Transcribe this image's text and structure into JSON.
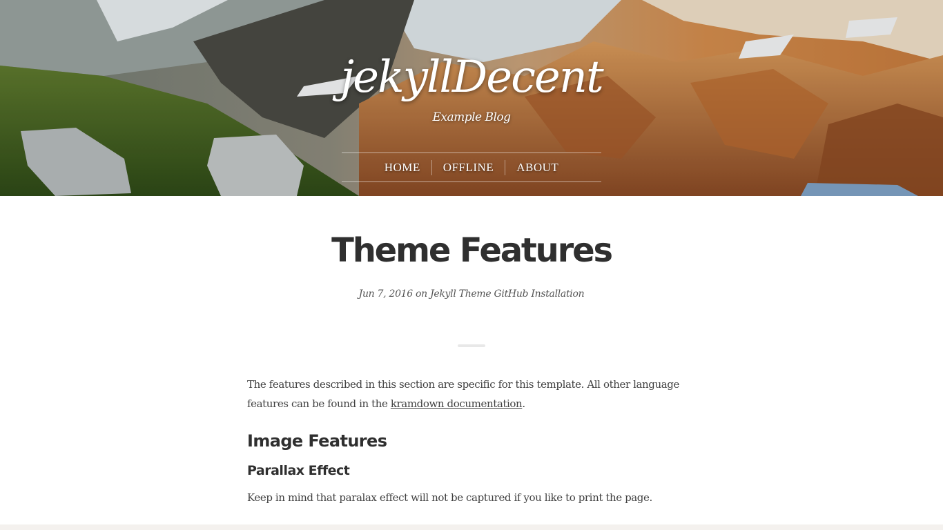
{
  "site": {
    "title": "jekyllDecent",
    "tagline": "Example Blog"
  },
  "nav": {
    "items": [
      {
        "label": "HOME"
      },
      {
        "label": "OFFLINE"
      },
      {
        "label": "ABOUT"
      }
    ]
  },
  "post": {
    "title": "Theme Features",
    "meta": {
      "date": "Jun 7, 2016",
      "on": "on",
      "tags": [
        "Jekyll",
        "Theme",
        "GitHub",
        "Installation"
      ]
    },
    "intro": {
      "text_before": "The features described in this section are specific for this template. All other language features can be found in the ",
      "link": "kramdown documentation",
      "text_after": "."
    },
    "h2": "Image Features",
    "h3": "Parallax Effect",
    "paragraph": "Keep in mind that paralax effect will not be captured if you like to print the page."
  }
}
